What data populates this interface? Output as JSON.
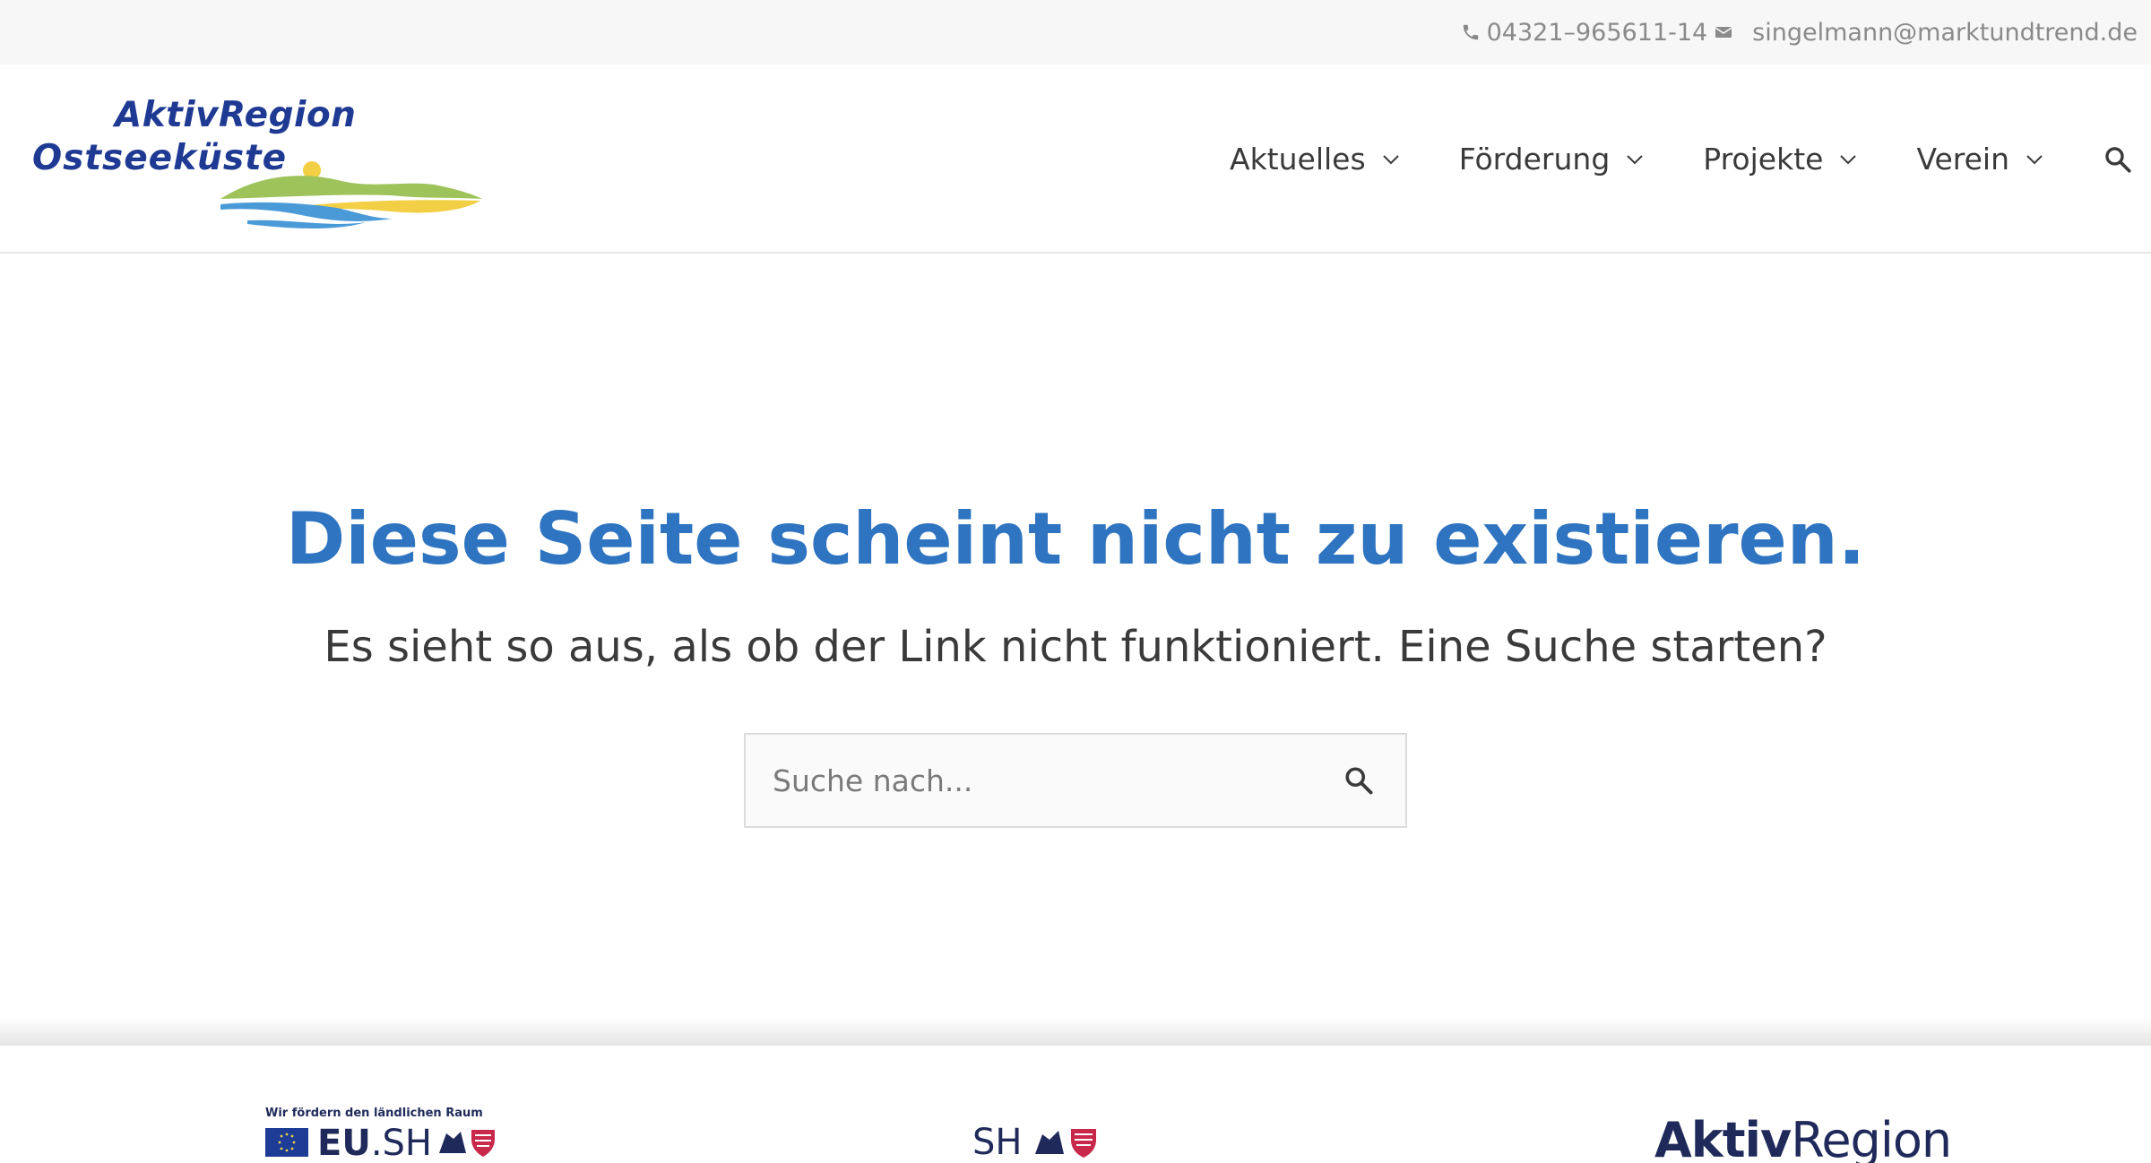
{
  "topbar": {
    "phone": "04321–965611-14",
    "email": "singelmann@marktundtrend.de",
    "phone_icon": "phone-icon",
    "email_icon": "envelope-icon"
  },
  "header": {
    "logo_line1": "AktivRegion",
    "logo_line2": "Ostseeküste",
    "nav": [
      {
        "label": "Aktuelles"
      },
      {
        "label": "Förderung"
      },
      {
        "label": "Projekte"
      },
      {
        "label": "Verein"
      }
    ],
    "search_icon": "search-icon"
  },
  "main": {
    "title": "Diese Seite scheint nicht zu existieren.",
    "subtitle": "Es sieht so aus, als ob der Link nicht funktioniert. Eine Suche starten?",
    "search": {
      "placeholder": "Suche nach..."
    }
  },
  "footer": {
    "eu_tagline": "Wir fördern den ländlichen Raum",
    "eu_prefix": "EU",
    "eu_suffix": ".SH",
    "sh_label": "SH",
    "ar_bold": "Aktiv",
    "ar_regular": "Region"
  },
  "colors": {
    "accent": "#2e74c0",
    "logo_navy": "#1f3a93",
    "text": "#3a3a3a",
    "topbar_bg": "#f7f7f7"
  }
}
